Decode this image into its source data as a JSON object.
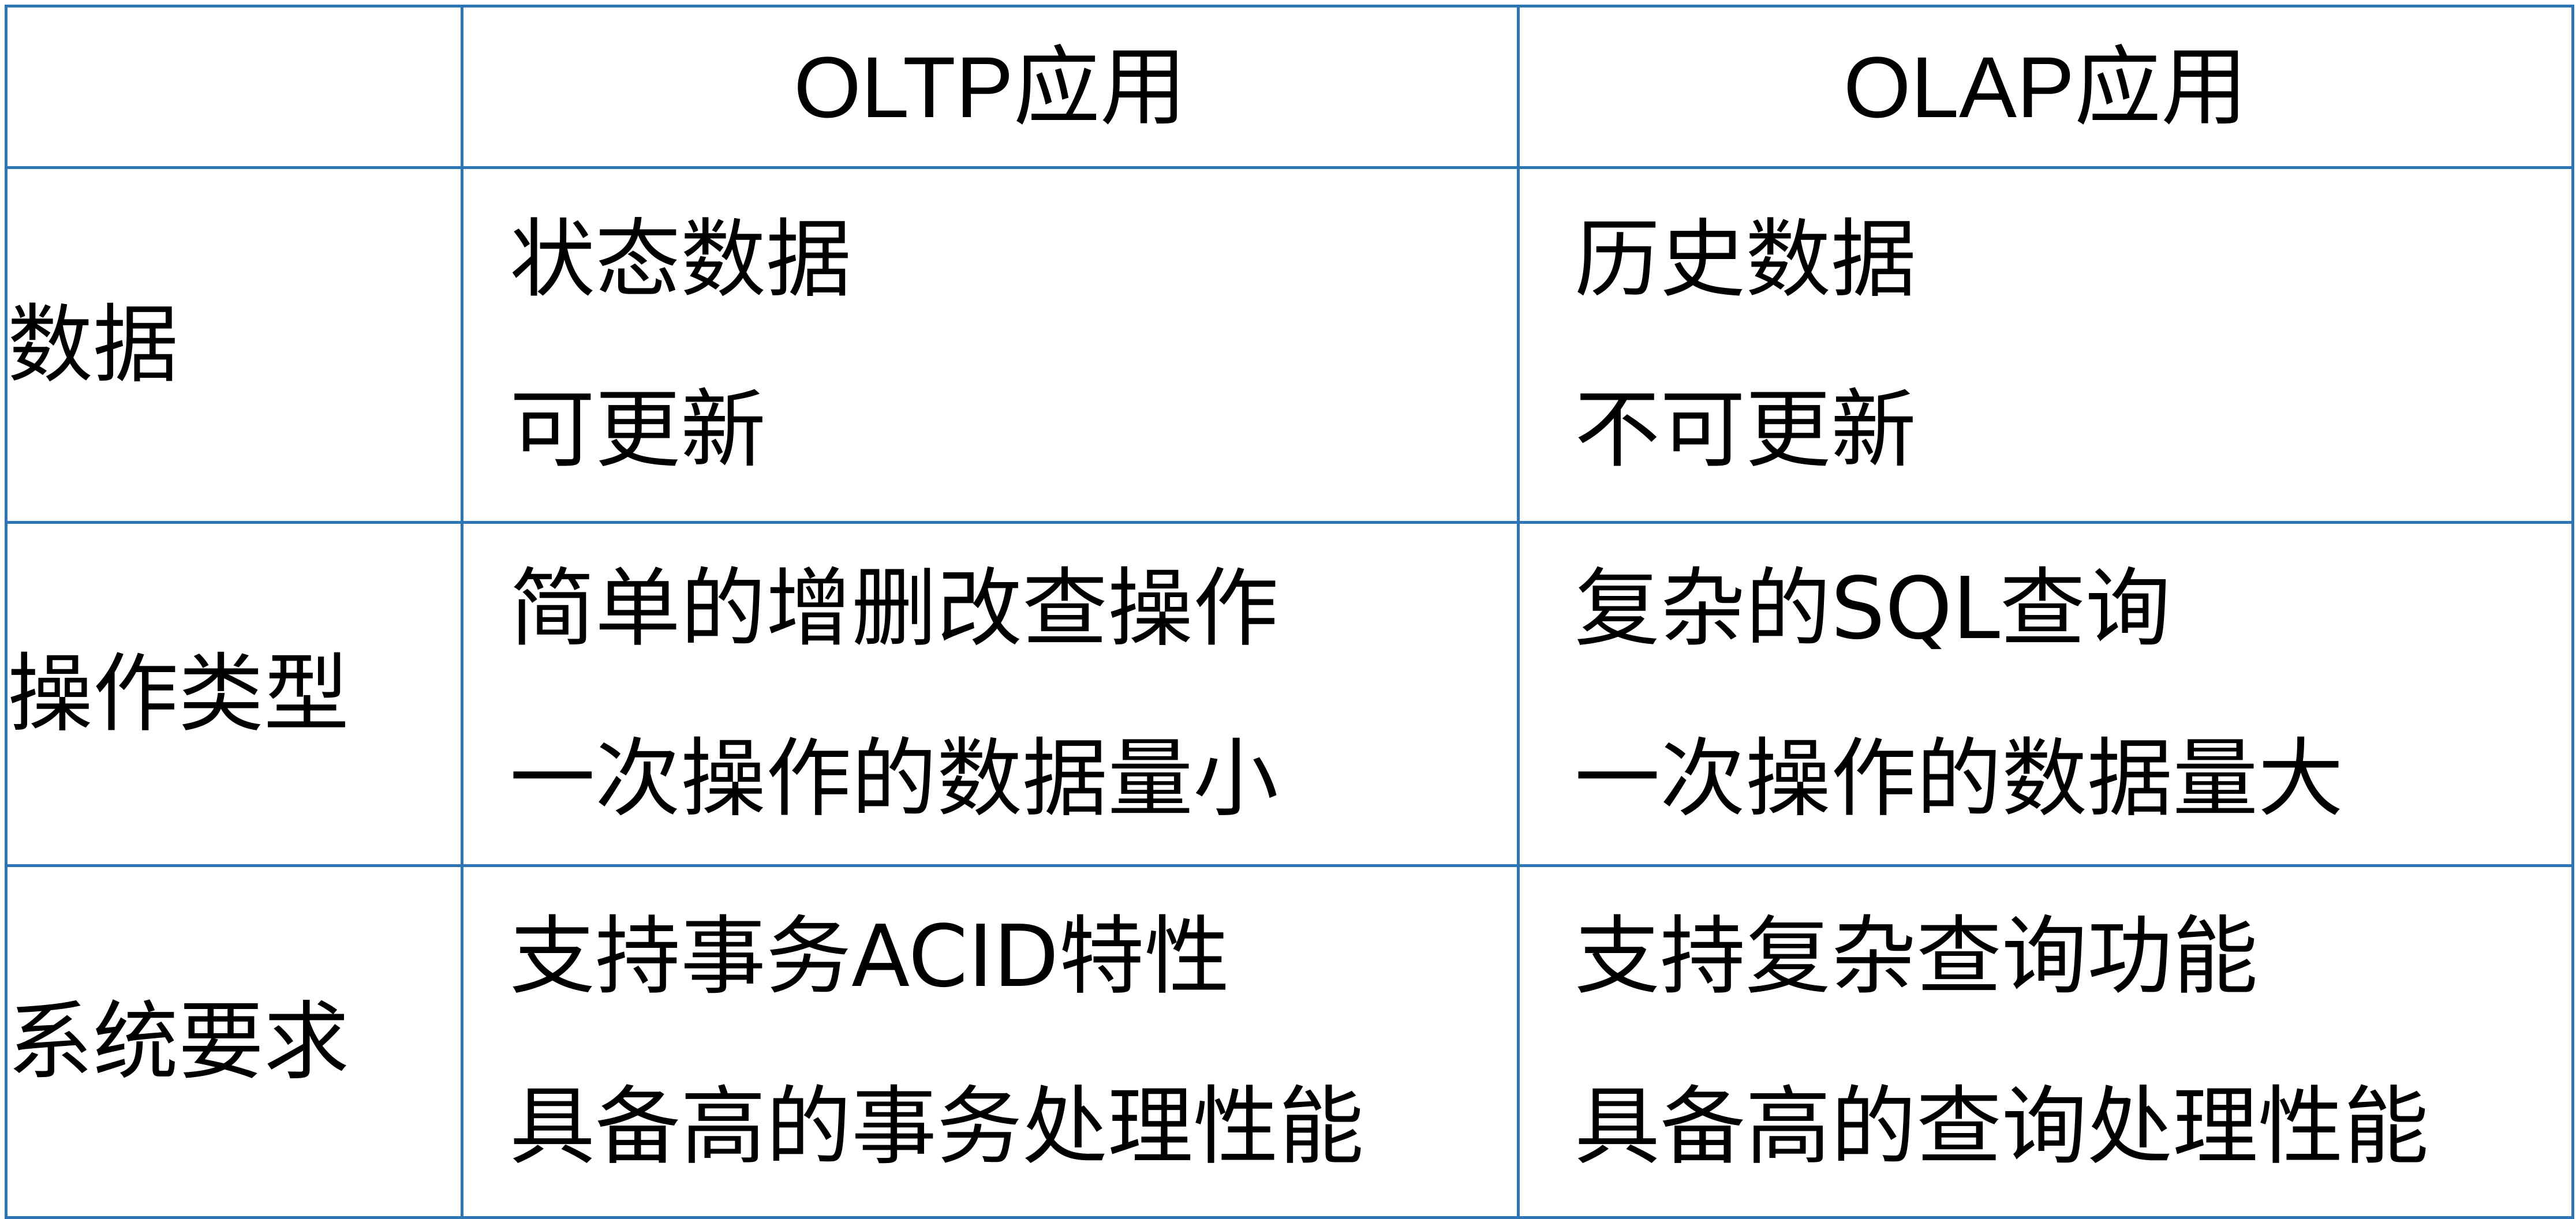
{
  "table": {
    "header": {
      "corner": "",
      "oltp": "OLTP应用",
      "olap": "OLAP应用"
    },
    "rows": [
      {
        "label": "数据",
        "oltp": [
          "状态数据",
          "可更新"
        ],
        "olap": [
          "历史数据",
          "不可更新"
        ]
      },
      {
        "label": "操作类型",
        "oltp": [
          "简单的增删改查操作",
          "一次操作的数据量小"
        ],
        "olap": [
          "复杂的SQL查询",
          "一次操作的数据量大"
        ]
      },
      {
        "label": "系统要求",
        "oltp": [
          "支持事务ACID特性",
          "具备高的事务处理性能"
        ],
        "olap": [
          "支持复杂查询功能",
          "具备高的查询处理性能"
        ]
      }
    ]
  },
  "colors": {
    "border": "#2e75b6",
    "text": "#000000",
    "background": "#ffffff"
  }
}
